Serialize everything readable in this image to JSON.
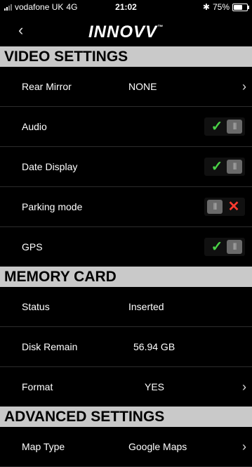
{
  "status_bar": {
    "carrier": "vodafone UK",
    "network": "4G",
    "time": "21:02",
    "battery": "75%",
    "battery_level": 0.75
  },
  "nav": {
    "back_icon": "chevron-left-icon",
    "logo": "INNOVV",
    "logo_tm": "™"
  },
  "video_settings": {
    "title": "VIDEO SETTINGS",
    "rear_mirror": {
      "label": "Rear Mirror",
      "value": "NONE"
    },
    "audio": {
      "label": "Audio",
      "on": true
    },
    "date_display": {
      "label": "Date Display",
      "on": true
    },
    "parking_mode": {
      "label": "Parking mode",
      "on": false
    },
    "gps": {
      "label": "GPS",
      "on": true
    }
  },
  "memory_card": {
    "title": "MEMORY CARD",
    "status": {
      "label": "Status",
      "value": "Inserted"
    },
    "disk_remain": {
      "label": "Disk Remain",
      "value": "56.94 GB"
    },
    "format": {
      "label": "Format",
      "value": "YES"
    }
  },
  "advanced_settings": {
    "title": "ADVANCED SETTINGS",
    "map_type": {
      "label": "Map Type",
      "value": "Google Maps"
    }
  },
  "colors": {
    "check_green": "#49d146",
    "cross_red": "#ff3b30",
    "header_gray": "#c9c9c9"
  },
  "toggle_glyphs": {
    "check": "✓",
    "cross": "✕",
    "grip": "|||"
  }
}
